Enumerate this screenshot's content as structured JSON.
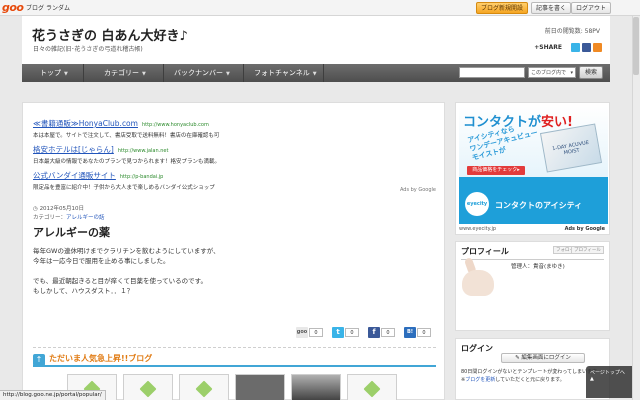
{
  "topbar": {
    "logo": "goo",
    "links": [
      "ブログ",
      "ランダム"
    ],
    "buttons": [
      "ブログ新規開設",
      "記事を書く",
      "ログアウト"
    ]
  },
  "header": {
    "title": "花うさぎの 白あん大好き♪",
    "subtitle": "日々の雑記(旧･花うさぎの弓道れ稽古帳)",
    "pv": "前日の閲覧数: 58PV",
    "share_label": "+SHARE"
  },
  "nav": {
    "items": [
      "トップ",
      "カテゴリー",
      "バックナンバー",
      "フォトチャンネル"
    ],
    "select": "このブログ内で",
    "go": "検索"
  },
  "ads": [
    {
      "title": "≪書籍通販≫HonyaClub.com",
      "url": "http://www.honyaclub.com",
      "desc": "本は本屋で。サイトで注文して、書店受取で送料無料！書店の在庫確認も可"
    },
    {
      "title": "格安ホテルは[じゃらん]",
      "url": "http://www.jalan.net",
      "desc": "日本最大級の情報であなたのプランで見つかられます！格安プランも満載。"
    },
    {
      "title": "公式バンダイ通販サイト",
      "url": "http://p-bandai.jp",
      "desc": "限定品を豊富に紹介中！子供から大人まで楽しめるバンダイ公式ショップ"
    }
  ],
  "ads_by_google": "Ads by Google",
  "post": {
    "date": "2012年05月10日",
    "category_label": "カテゴリー：",
    "category": "アレルギーの話",
    "title": "アレルギーの薬",
    "body": [
      "毎年GWの連休明けまでクラリチンを飲むようにしていますが、",
      "今年は一応今日で服用を止める事にしました。",
      "",
      "でも、最近朝起きると目が痒くて目薬を使っているのです。",
      "もしかして、ハウスダスト．．１？"
    ]
  },
  "social_counts": [
    "0",
    "0",
    "0",
    "0"
  ],
  "ranking": {
    "title": "ただいま人気急上昇!!ブログ"
  },
  "sidebar": {
    "ad": {
      "headline_a": "コンタクトが",
      "headline_b": "安い!",
      "diagonal": "アイシティなら\nワンデーアキュビュー\nモイストが",
      "box_text": "1-DAY ACUVUE MOIST",
      "cta": "商品価格をチェック▸",
      "logo": "eyecity",
      "tagline": "コンタクトのアイシティ",
      "url": "www.eyecity.jp",
      "ads": "Ads by Google"
    },
    "profile": {
      "title": "プロフィール",
      "buttons": [
        "フォロー",
        "プロフィール"
      ],
      "owner": "管理人：貴音(まゆき)"
    },
    "login": {
      "title": "ログイン",
      "button": "編集画面にログイン",
      "note_1": "80日間ログインがないとテンプレートが変わってしまいます",
      "note_2_link": "ブログを更新",
      "note_2_rest": "していただくと元に戻ります。"
    }
  },
  "pagetop": "ページトップへ",
  "status": "http://blog.goo.ne.jp/portal/popular/"
}
